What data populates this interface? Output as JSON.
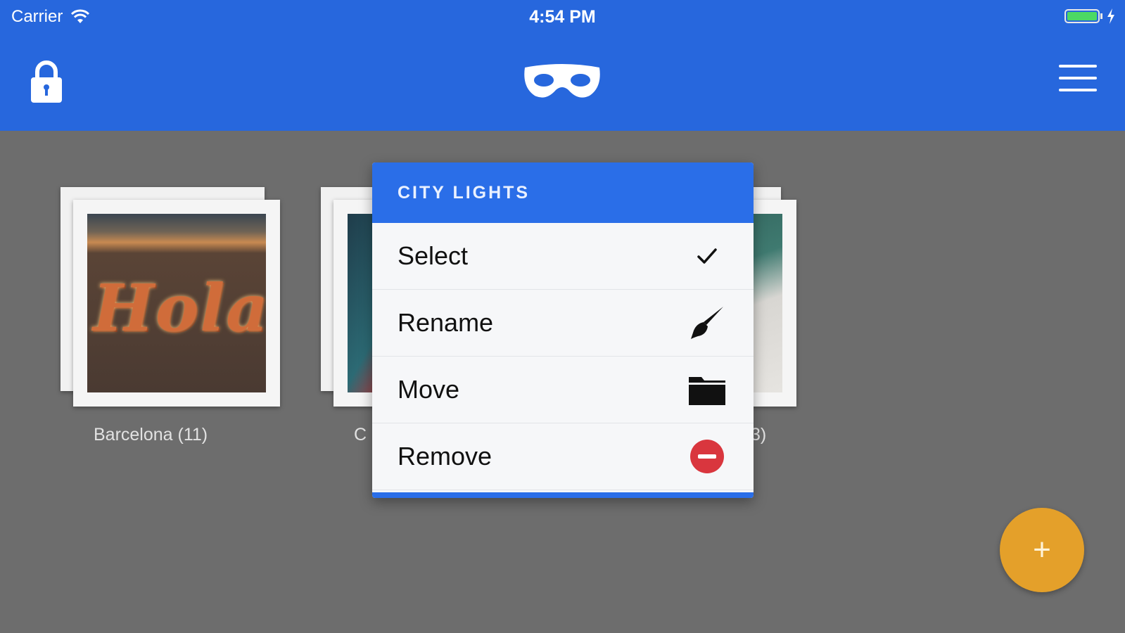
{
  "status_bar": {
    "carrier": "Carrier",
    "time": "4:54 PM",
    "battery_level": 1.0
  },
  "nav": {
    "left_icon": "lock-icon",
    "center_icon": "mask-icon",
    "right_icon": "hamburger-menu-icon"
  },
  "albums": [
    {
      "caption": "Barcelona (11)",
      "thumbnail_text": "Hola"
    },
    {
      "caption": "C"
    },
    {
      "caption": "3)"
    }
  ],
  "context_menu": {
    "title": "CITY LIGHTS",
    "items": [
      {
        "label": "Select",
        "icon": "checkmark-icon"
      },
      {
        "label": "Rename",
        "icon": "brush-icon"
      },
      {
        "label": "Move",
        "icon": "folder-icon"
      },
      {
        "label": "Remove",
        "icon": "minus-circle-icon"
      }
    ]
  },
  "fab": {
    "label": "+"
  },
  "colors": {
    "primary": "#2767dd",
    "menu_header": "#2a6ee8",
    "backdrop": "#6d6d6d",
    "fab": "#e4a02a",
    "remove": "#d9363e"
  }
}
